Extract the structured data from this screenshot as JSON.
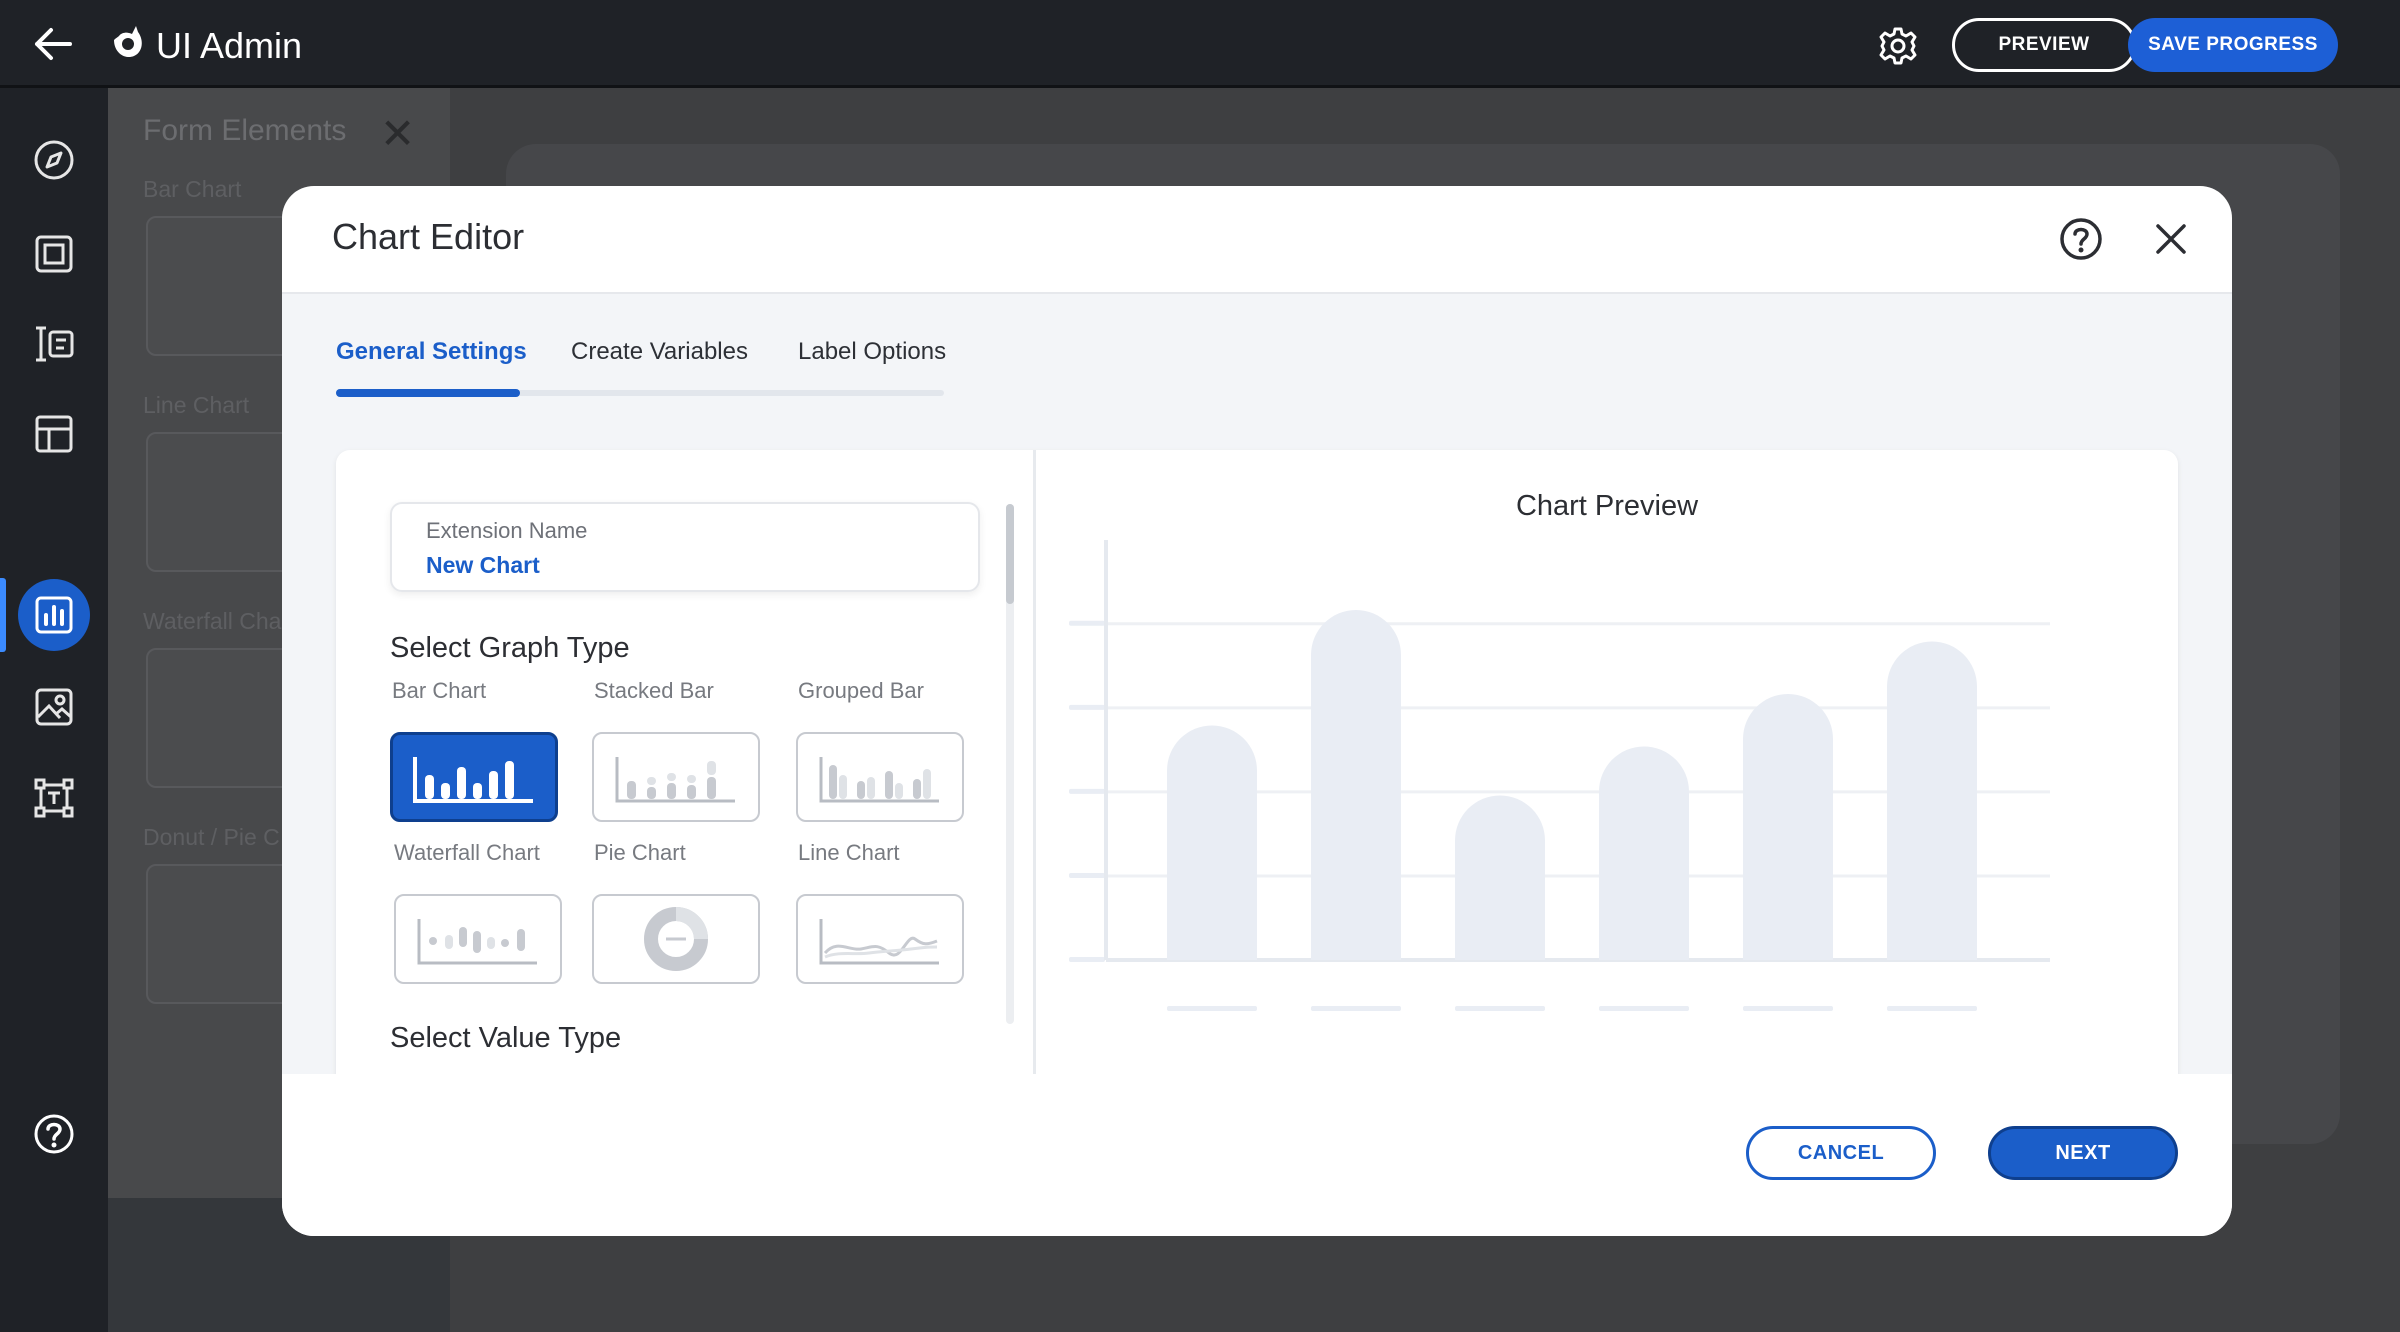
{
  "header": {
    "app_title": "UI Admin",
    "preview_label": "PREVIEW",
    "save_label": "SAVE PROGRESS"
  },
  "rail": {
    "items": [
      {
        "icon": "compass-icon"
      },
      {
        "icon": "frame-icon"
      },
      {
        "icon": "text-field-icon"
      },
      {
        "icon": "table-icon"
      },
      {
        "icon": "chart-icon",
        "active": true
      },
      {
        "icon": "image-icon"
      },
      {
        "icon": "text-box-icon"
      }
    ],
    "help_icon": "help-icon"
  },
  "background_panel": {
    "title": "Form Elements",
    "labels": [
      "Bar Chart",
      "Line Chart",
      "Waterfall Cha",
      "Donut / Pie C"
    ]
  },
  "modal": {
    "title": "Chart Editor",
    "tabs": [
      {
        "label": "General Settings",
        "active": true
      },
      {
        "label": "Create Variables"
      },
      {
        "label": "Label Options"
      }
    ],
    "extension": {
      "label": "Extension Name",
      "value": "New Chart"
    },
    "graph_type_title": "Select Graph Type",
    "graph_types": [
      {
        "label": "Bar Chart",
        "icon": "bar-chart-icon",
        "selected": true
      },
      {
        "label": "Stacked Bar",
        "icon": "stacked-bar-icon"
      },
      {
        "label": "Grouped Bar",
        "icon": "grouped-bar-icon"
      },
      {
        "label": "Waterfall Chart",
        "icon": "waterfall-chart-icon"
      },
      {
        "label": "Pie Chart",
        "icon": "pie-chart-icon"
      },
      {
        "label": "Line Chart",
        "icon": "line-chart-icon"
      }
    ],
    "value_type_title": "Select Value Type",
    "preview_title": "Chart Preview",
    "cancel_label": "CANCEL",
    "next_label": "NEXT"
  },
  "colors": {
    "accent": "#1b5ec9",
    "placeholder_bar": "#e9edf4"
  },
  "chart_data": {
    "type": "bar",
    "title": "Chart Preview",
    "categories": [
      "",
      "",
      "",
      "",
      "",
      ""
    ],
    "values": [
      67,
      100,
      47,
      61,
      76,
      91
    ],
    "grid": true,
    "note": "placeholder preview with no axis labels"
  }
}
